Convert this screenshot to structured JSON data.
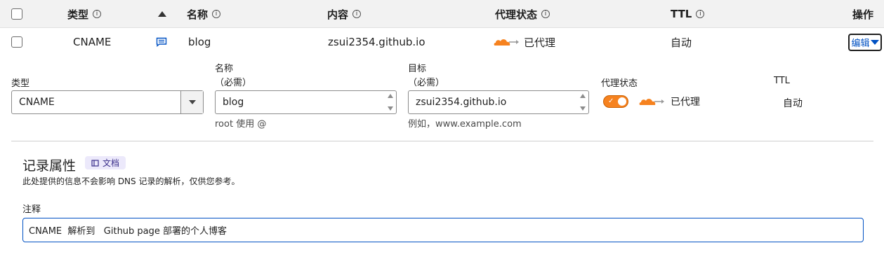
{
  "header": {
    "type_label": "类型",
    "name_label": "名称",
    "content_label": "内容",
    "proxy_label": "代理状态",
    "ttl_label": "TTL",
    "actions_label": "操作"
  },
  "record": {
    "type": "CNAME",
    "name": "blog",
    "content": "zsui2354.github.io",
    "proxy_status": "已代理",
    "ttl": "自动",
    "edit_label": "编辑"
  },
  "form": {
    "type_label": "类型",
    "type_value": "CNAME",
    "name_label": "名称",
    "name_required": "（必需）",
    "name_value": "blog",
    "name_hint": "root 使用 @",
    "target_label": "目标",
    "target_required": "（必需）",
    "target_value": "zsui2354.github.io",
    "target_hint": "例如，www.example.com",
    "proxy_label": "代理状态",
    "proxy_status": "已代理",
    "proxy_enabled": true,
    "ttl_label": "TTL",
    "ttl_value": "自动"
  },
  "attributes": {
    "title": "记录属性",
    "docs_badge": "文档",
    "description": "此处提供的信息不会影响 DNS 记录的解析，仅供您参考。",
    "comment_label": "注释",
    "comment_value": "CNAME  解析到   Github page 部署的个人博客"
  },
  "colors": {
    "accent_orange": "#f6821f",
    "link_blue": "#0051c3",
    "badge_bg": "#ece9fb"
  },
  "icons": {
    "info": "info-circle-icon",
    "sort": "sort-up-icon",
    "comment": "comment-icon",
    "cloud": "orange-cloud-proxied-icon",
    "docs": "book-icon"
  }
}
